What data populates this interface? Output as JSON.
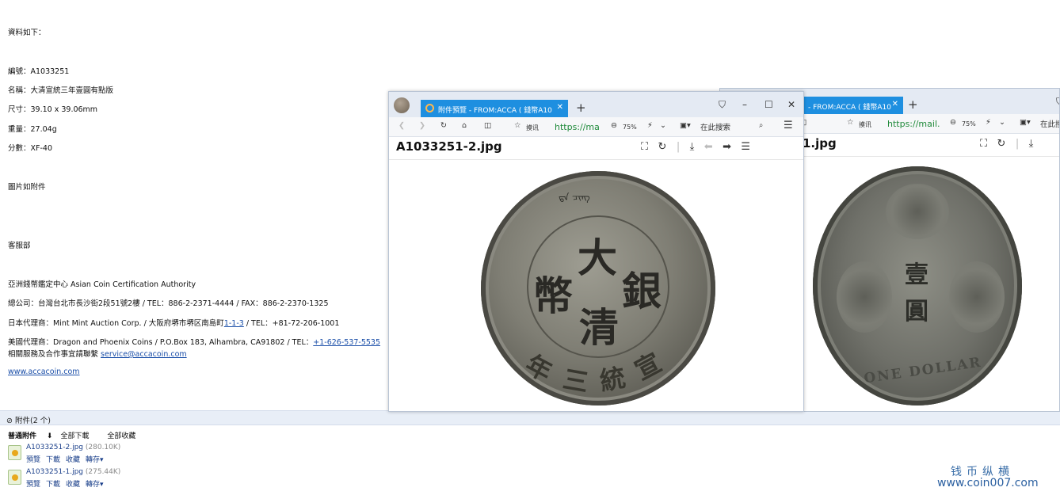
{
  "mail": {
    "intro": "資料如下：",
    "number": "編號：A1033251",
    "name": "名稱：大清宣統三年壹圓有點版",
    "size": "尺寸：39.10 x 39.06mm",
    "weight": "重量：27.04g",
    "grade": "分數：XF-40",
    "images_note": "圖片如附件",
    "dept": "客服部",
    "org": "亞洲錢幣鑑定中心  Asian Coin Certification Authority",
    "hq": "總公司：台灣台北市長沙街2段51號2樓 / TEL：886-2-2371-4444 / FAX：886-2-2370-1325",
    "jp": "日本代理商：Mint Mint Auction Corp. / 大阪府堺市堺区南島町",
    "jp_link": "1-1-3",
    "jp_tel": " / TEL：+81-72-206-1001",
    "us": "美國代理商：Dragon and Phoenix Coins / P.O.Box 183, Alhambra, CA91802 / TEL：",
    "us_tel": "+1-626-537-5535",
    "contact": "相關服務及合作事宜請聯繫 ",
    "contact_email": "service@accacoin.com",
    "website": "www.accacoin.com"
  },
  "attachments": {
    "header": "附件(2 个)",
    "normal": "普通附件",
    "download_all": "全部下載",
    "save_all": "全部收藏",
    "files": [
      {
        "name": "A1033251-2.jpg",
        "size": "(280.10K)"
      },
      {
        "name": "A1033251-1.jpg",
        "size": "(275.44K)"
      }
    ],
    "actions": {
      "preview": "預覽",
      "download": "下載",
      "save": "收藏",
      "forward": "轉存▾"
    }
  },
  "watermark": {
    "cn": "钱币纵横",
    "url": "www.coin007.com"
  },
  "win1": {
    "tab_title": "附件預覽 - FROM:ACCA ( 錢幣A10",
    "url": "https://ma",
    "zoom": "75%",
    "search_placeholder": "在此搜索",
    "favorites": "摸讯",
    "file_title": "A1033251-2.jpg"
  },
  "win2": {
    "tab_title": "- FROM:ACCA ( 錢幣A10",
    "url": "https://mail.",
    "zoom": "75%",
    "search_placeholder": "在此搜",
    "favorites": "摸讯",
    "file_title": "1.jpg"
  },
  "coin_obverse": {
    "center_top": "大",
    "center_left": "幣",
    "center_right": "銀",
    "center_bottom": "清",
    "rim_bottom": [
      "年",
      "三",
      "統",
      "宣"
    ],
    "rim_top_mono": "ᠳᠠ ᠴᠢᠩ"
  },
  "coin_reverse": {
    "center_top": "壹",
    "center_bottom": "圓",
    "rim_bottom": "ONE DOLLAR"
  }
}
